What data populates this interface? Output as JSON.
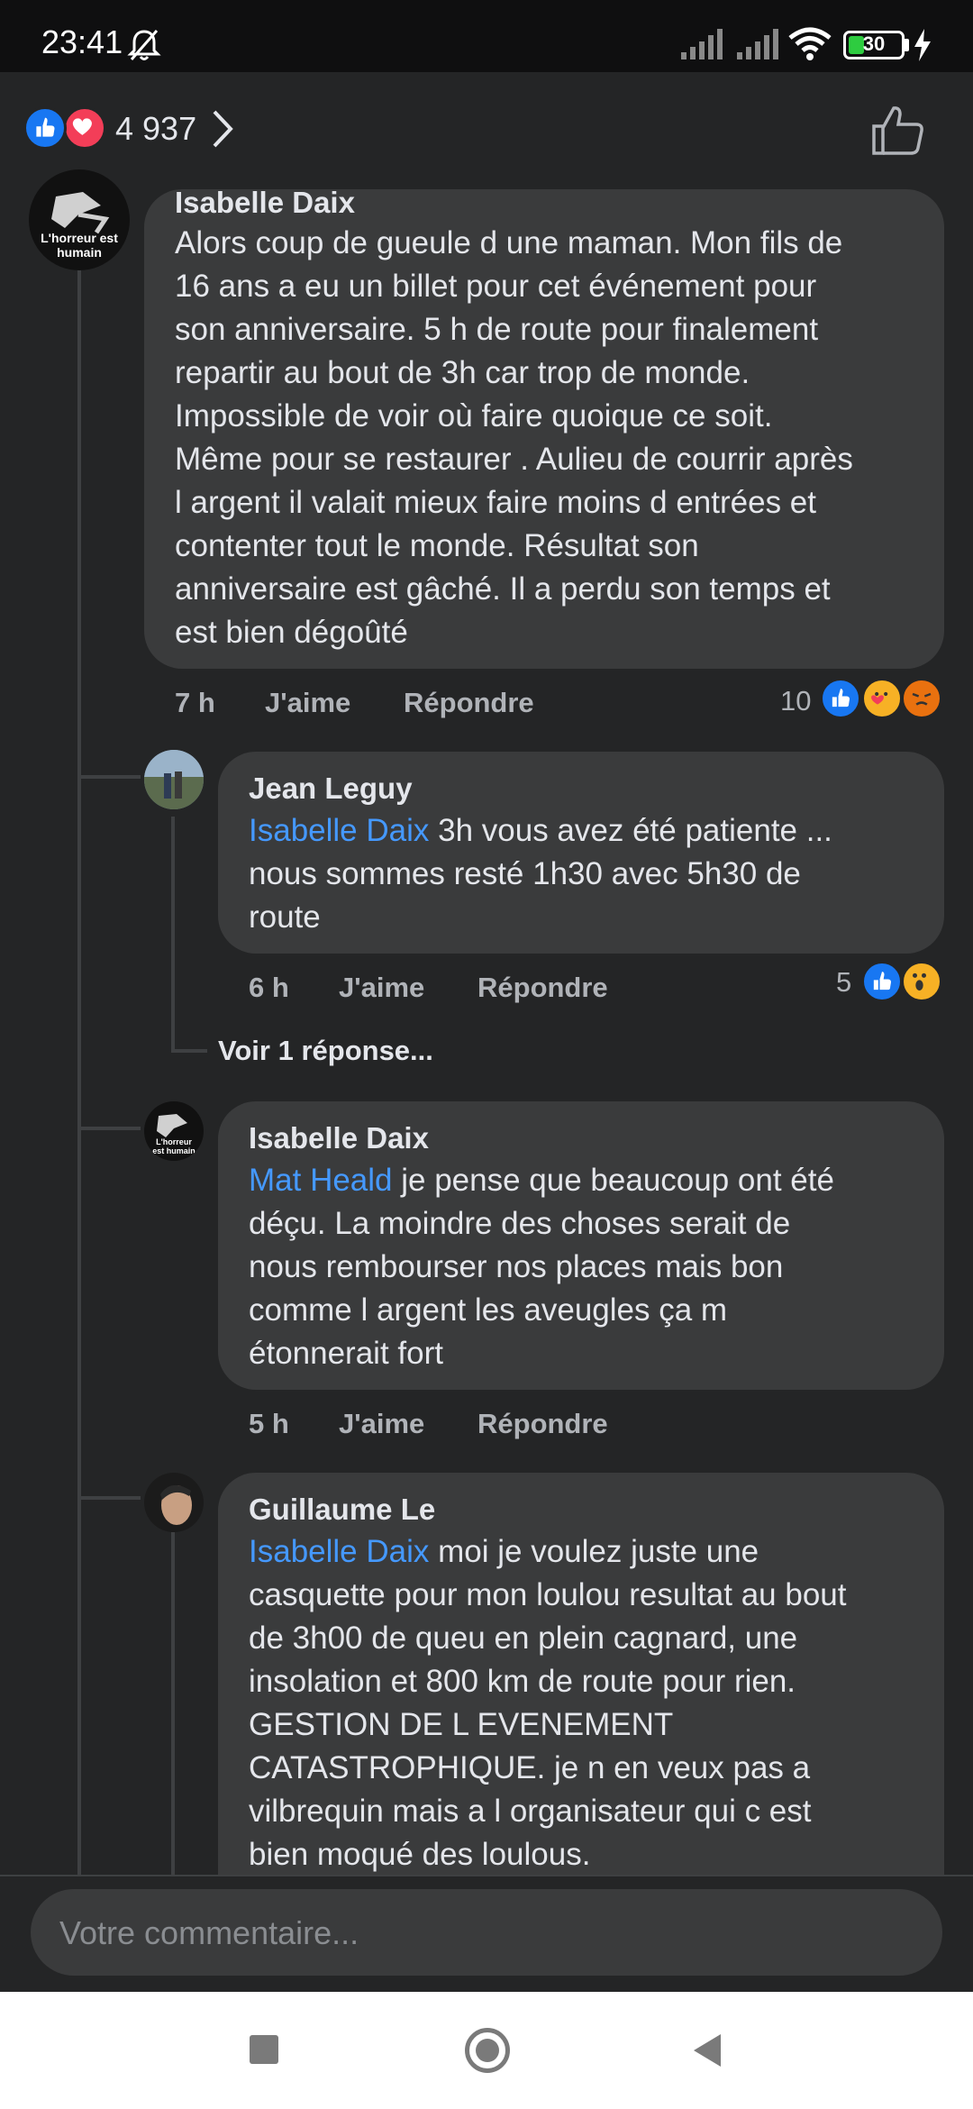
{
  "status": {
    "time": "23:41",
    "battery": "30",
    "battery_level": 0.3
  },
  "header": {
    "reaction_count": "4 937"
  },
  "comments": [
    {
      "name": "Isabelle Daix",
      "avatar_text": "L'horreur est humain",
      "lines": [
        "Alors coup de gueule d une maman. Mon fils de",
        "16 ans a eu un billet pour cet événement pour",
        "son anniversaire.  5 h de route pour finalement",
        "repartir au bout de 3h car trop de monde.",
        "Impossible de voir où faire quoique ce soit.",
        "Même pour se restaurer . Aulieu de courrir après",
        "l argent il valait mieux faire moins d entrées et",
        "contenter tout le monde.  Résultat son",
        "anniversaire est gâché.  Il a perdu son temps et",
        "est bien dégoûté"
      ],
      "time": "7 h",
      "like": "J'aime",
      "reply": "Répondre",
      "reaction_count": "10",
      "reactions": [
        "like-icon",
        "care-icon",
        "angry-icon"
      ]
    },
    {
      "name": "Jean Leguy",
      "mention": "Isabelle Daix",
      "lines": [
        " 3h vous avez été patiente ...",
        "nous sommes resté 1h30 avec 5h30 de",
        "route"
      ],
      "time": "6 h",
      "like": "J'aime",
      "reply": "Répondre",
      "reaction_count": "5",
      "reactions": [
        "like-icon",
        "wow-icon"
      ]
    },
    {
      "name": "Isabelle Daix",
      "avatar_text": "L'horreur est humain",
      "mention": "Mat Heald",
      "lines": [
        " je pense que beaucoup ont été",
        "déçu.  La moindre des choses serait de",
        "nous rembourser nos places mais bon",
        "comme l argent les aveugles ça m",
        "étonnerait fort"
      ],
      "time": "5 h",
      "like": "J'aime",
      "reply": "Répondre"
    },
    {
      "name": "Guillaume Le",
      "mention": "Isabelle Daix",
      "lines": [
        " moi je voulez juste une",
        "casquette pour mon loulou resultat au bout",
        "de 3h00 de queu en plein cagnard, une",
        "insolation et 800 km de route pour rien.",
        "GESTION DE L EVENEMENT",
        "CATASTROPHIQUE. je n en veux pas a",
        "vilbrequin mais a l organisateur qui c est",
        "bien moqué des loulous."
      ]
    }
  ],
  "more_replies": "Voir 1 réponse...",
  "composer": {
    "placeholder": "Votre commentaire..."
  },
  "colors": {
    "background": "#242526",
    "bubble": "#3a3b3c",
    "mention": "#4599ff",
    "like": "#1877f2",
    "love": "#f33e58"
  }
}
